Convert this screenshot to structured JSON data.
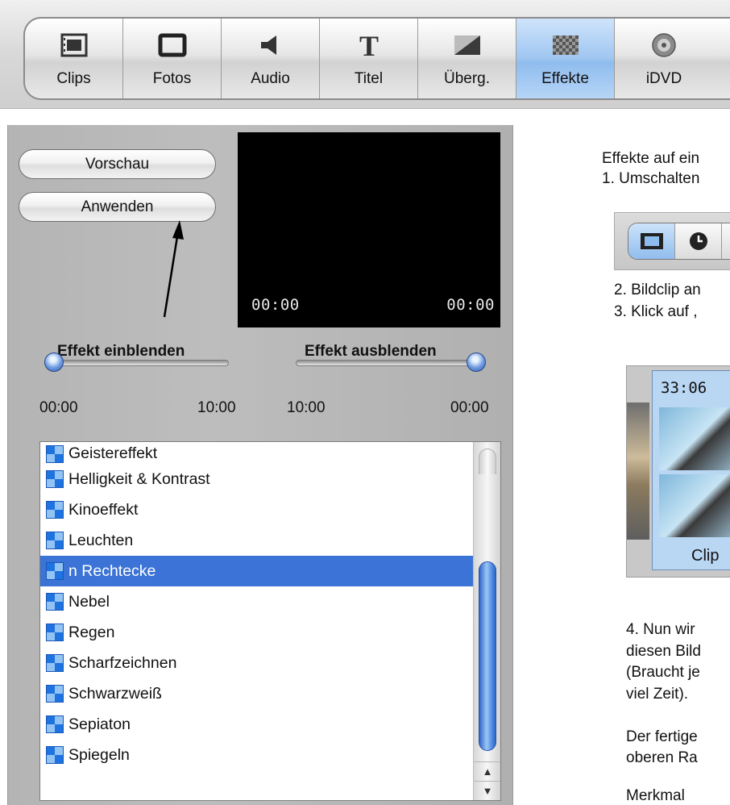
{
  "toolbar": {
    "buttons": [
      {
        "label": "Clips",
        "icon": "film-icon",
        "active": false
      },
      {
        "label": "Fotos",
        "icon": "photo-frame-icon",
        "active": false
      },
      {
        "label": "Audio",
        "icon": "speaker-icon",
        "active": false
      },
      {
        "label": "Titel",
        "icon": "title-t-icon",
        "active": false
      },
      {
        "label": "Überg.",
        "icon": "transition-icon",
        "active": false
      },
      {
        "label": "Effekte",
        "icon": "effects-checker-icon",
        "active": true
      },
      {
        "label": "iDVD",
        "icon": "dvd-disc-icon",
        "active": false
      }
    ]
  },
  "effects_panel": {
    "preview_label": "Vorschau",
    "apply_label": "Anwenden",
    "timecode_start": "00:00",
    "timecode_end": "00:00",
    "fade_in": {
      "title": "Effekt einblenden",
      "min": "00:00",
      "max": "10:00",
      "value": 0
    },
    "fade_out": {
      "title": "Effekt ausblenden",
      "min": "10:00",
      "max": "00:00",
      "value": 1
    },
    "effects": [
      "Geistereffekt",
      "Helligkeit & Kontrast",
      "Kinoeffekt",
      "Leuchten",
      "n Rechtecke",
      "Nebel",
      "Regen",
      "Scharfzeichnen",
      "Schwarzweiß",
      "Sepiaton",
      "Spiegeln"
    ],
    "selected_effect": "n Rechtecke"
  },
  "instructions": {
    "line_1": "Effekte auf ein",
    "line_2": "1. Umschalten",
    "line_3": "2. Bildclip an",
    "line_4": "3. Klick auf ,",
    "clip_time": "33:06",
    "clip_name": "Clip",
    "line_5": "4. Nun wir",
    "line_6": "diesen Bild",
    "line_7": "(Braucht je",
    "line_8": "viel Zeit).",
    "line_9": "Der fertige",
    "line_10": "oberen Ra",
    "line_11": "Merkmal"
  }
}
